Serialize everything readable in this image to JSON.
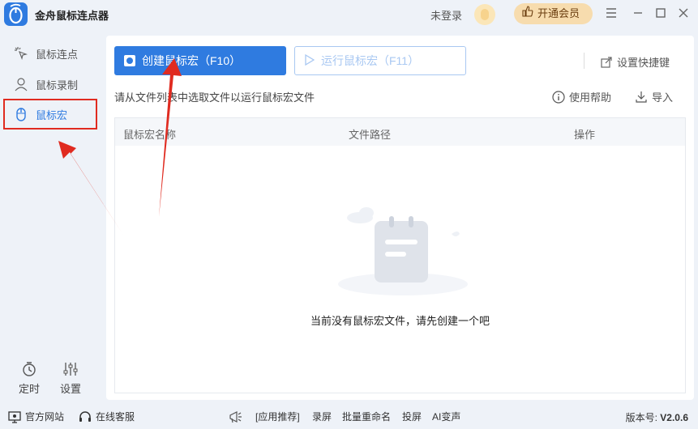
{
  "app": {
    "title": "金舟鼠标连点器",
    "login_status": "未登录",
    "vip_button": "开通会员",
    "accent_color": "#2f7be0",
    "annotation_color": "#e02b20"
  },
  "sidebar": {
    "items": [
      {
        "label": "鼠标连点",
        "icon": "cursor-click-icon"
      },
      {
        "label": "鼠标录制",
        "icon": "user-record-icon"
      },
      {
        "label": "鼠标宏",
        "icon": "mouse-icon",
        "active": true
      }
    ],
    "bottom": [
      {
        "label": "定时",
        "icon": "timer-icon"
      },
      {
        "label": "设置",
        "icon": "sliders-icon"
      }
    ]
  },
  "toolbar": {
    "create_label": "创建鼠标宏（F10）",
    "run_label": "运行鼠标宏（F11）",
    "shortcut_label": "设置快捷键"
  },
  "content": {
    "hint": "请从文件列表中选取文件以运行鼠标宏文件",
    "help_label": "使用帮助",
    "import_label": "导入"
  },
  "table": {
    "columns": [
      "鼠标宏名称",
      "文件路径",
      "操作"
    ],
    "rows": [],
    "empty_text": "当前没有鼠标宏文件，请先创建一个吧"
  },
  "bottombar": {
    "website": "官方网站",
    "support": "在线客服",
    "recommend": "[应用推荐]",
    "links": [
      "录屏",
      "批量重命名",
      "投屏",
      "AI变声"
    ],
    "version_label": "版本号:",
    "version": "V2.0.6"
  }
}
